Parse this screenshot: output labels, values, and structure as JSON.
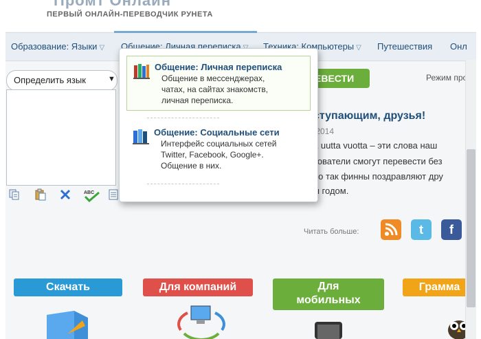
{
  "header": {
    "logo_text": "Промт Онлайн",
    "tagline": "ПЕРВЫЙ ОНЛАЙН-ПЕРЕВОДЧИК РУНЕТА"
  },
  "nav": {
    "items": [
      {
        "label": "Образование: Языки",
        "caret": "▽"
      },
      {
        "label": "Общение: Личная переписка",
        "caret": "▽"
      },
      {
        "label": "Техника: Компьютеры",
        "caret": "▽"
      },
      {
        "label": "Путешествия",
        "caret": ""
      },
      {
        "label": "Онл",
        "caret": ""
      }
    ]
  },
  "translator": {
    "language_select": "Определить язык",
    "translate_button": "ЕВЕСТИ",
    "mode_label": "Режим про"
  },
  "popup": {
    "items": [
      {
        "title": "Общение: Личная переписка",
        "desc": [
          "Общение в мессенджерах,",
          "чатах, на сайтах знакомств,",
          "личная переписка."
        ]
      },
      {
        "title": "Общение: Социальные сети",
        "desc": [
          "Интерфейс социальных сетей",
          "Twitter, Facebook, Google+.",
          "Общение в них."
        ]
      }
    ]
  },
  "news": {
    "title": "ступающим, друзья!",
    "date": ".2014",
    "lines": [
      "ä uutta vuotta – эти слова наш",
      "зователи смогут перевести без",
      "но так финны поздравляют дру",
      "м годом."
    ],
    "read_more": "Читать больше:"
  },
  "social": {
    "rss": "ᴿˢˢ",
    "twitter": "t",
    "facebook": "f"
  },
  "banners": {
    "download": "Скачать",
    "companies": "Для компаний",
    "mobile_line1": "Для",
    "mobile_line2": "мобильных",
    "grammar": "Грамма"
  },
  "colors": {
    "nav_text": "#1f4f7a",
    "translate_button": "#6cae3c",
    "banner_download": "#2a9ad6",
    "banner_companies": "#e0504a",
    "banner_mobile": "#6cae3c",
    "banner_grammar": "#f2a418"
  },
  "icons": [
    "copy-icon",
    "paste-icon",
    "clear-icon",
    "spellcheck-icon",
    "document-icon",
    "book-icon",
    "rss-icon",
    "twitter-icon",
    "facebook-icon"
  ]
}
